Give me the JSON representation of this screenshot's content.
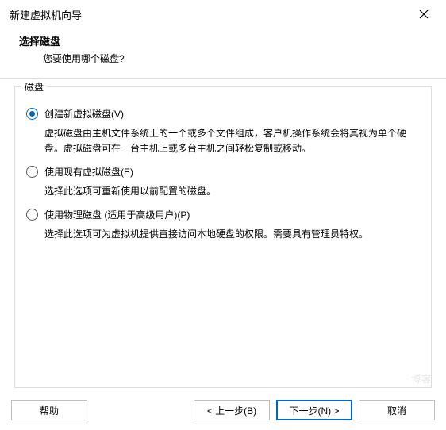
{
  "titlebar": {
    "title": "新建虚拟机向导"
  },
  "header": {
    "title": "选择磁盘",
    "subtitle": "您要使用哪个磁盘?"
  },
  "fieldset": {
    "legend": "磁盘"
  },
  "options": [
    {
      "label": "创建新虚拟磁盘(V)",
      "desc": "虚拟磁盘由主机文件系统上的一个或多个文件组成，客户机操作系统会将其视为单个硬盘。虚拟磁盘可在一台主机上或多台主机之间轻松复制或移动。",
      "selected": true
    },
    {
      "label": "使用现有虚拟磁盘(E)",
      "desc": "选择此选项可重新使用以前配置的磁盘。",
      "selected": false
    },
    {
      "label": "使用物理磁盘 (适用于高级用户)(P)",
      "desc": "选择此选项可为虚拟机提供直接访问本地硬盘的权限。需要具有管理员特权。",
      "selected": false
    }
  ],
  "buttons": {
    "help": "帮助",
    "back": "< 上一步(B)",
    "next": "下一步(N) >",
    "cancel": "取消"
  },
  "watermark": "博客"
}
